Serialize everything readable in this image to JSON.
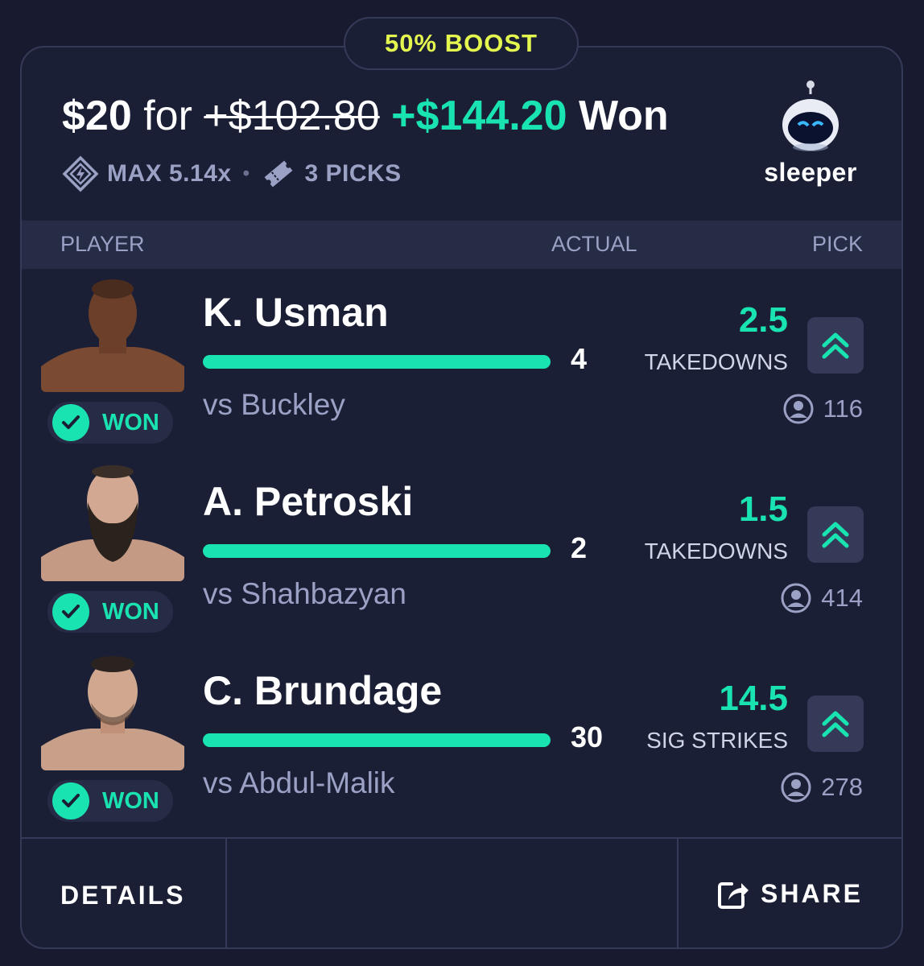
{
  "boost": {
    "label": "50% BOOST"
  },
  "summary": {
    "stake": "$20",
    "for_word": "for",
    "original_payout": "+$102.80",
    "boosted_payout": "+$144.20",
    "result": "Won",
    "max_multiplier": "MAX 5.14x",
    "separator": "•",
    "picks_count": "3 PICKS"
  },
  "brand": {
    "name": "sleeper",
    "logo_icon": "sleeper-robot-logo"
  },
  "columns": {
    "player": "PLAYER",
    "actual": "ACTUAL",
    "pick": "PICK"
  },
  "picks": [
    {
      "player": "K. Usman",
      "status": "WON",
      "actual": "4",
      "opponent": "vs Buckley",
      "line": "2.5",
      "stat": "TAKEDOWNS",
      "direction": "higher",
      "popularity": "116",
      "progress": 1.0
    },
    {
      "player": "A. Petroski",
      "status": "WON",
      "actual": "2",
      "opponent": "vs Shahbazyan",
      "line": "1.5",
      "stat": "TAKEDOWNS",
      "direction": "higher",
      "popularity": "414",
      "progress": 1.0
    },
    {
      "player": "C. Brundage",
      "status": "WON",
      "actual": "30",
      "opponent": "vs Abdul-Malik",
      "line": "14.5",
      "stat": "SIG STRIKES",
      "direction": "higher",
      "popularity": "278",
      "progress": 1.0
    }
  ],
  "footer": {
    "details_label": "DETAILS",
    "share_label": "SHARE"
  },
  "colors": {
    "accent": "#19e3b1",
    "boost": "#e4f74e",
    "background": "#1b1f35",
    "muted": "#9aa1c4"
  }
}
